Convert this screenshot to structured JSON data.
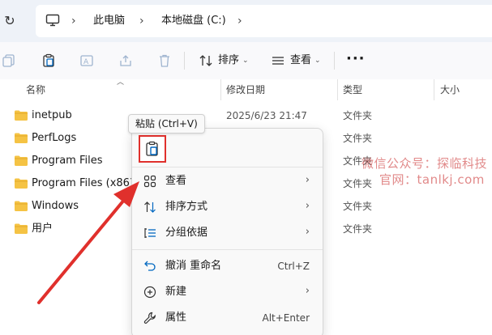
{
  "address_bar": {
    "crumbs": [
      "此电脑",
      "本地磁盘 (C:)"
    ]
  },
  "toolbar": {
    "sort_label": "排序",
    "view_label": "查看",
    "more_label": "···"
  },
  "columns": {
    "name": "名称",
    "date": "修改日期",
    "type": "类型",
    "size": "大小"
  },
  "files": [
    {
      "name": "inetpub",
      "date": "2025/6/23 21:47",
      "type": "文件夹"
    },
    {
      "name": "PerfLogs",
      "date": "",
      "type": "文件夹"
    },
    {
      "name": "Program Files",
      "date": "",
      "type": "文件夹"
    },
    {
      "name": "Program Files (x86)",
      "date": "",
      "type": "文件夹"
    },
    {
      "name": "Windows",
      "date": "",
      "type": "文件夹"
    },
    {
      "name": "用户",
      "date": "",
      "type": "文件夹"
    }
  ],
  "tooltip": "粘贴 (Ctrl+V)",
  "context_menu": {
    "view": "查看",
    "sort_by": "排序方式",
    "group_by": "分组依据",
    "undo": "撤消 重命名",
    "undo_shortcut": "Ctrl+Z",
    "new": "新建",
    "properties": "属性",
    "properties_shortcut": "Alt+Enter"
  },
  "watermark": {
    "line1": "微信公众号：探临科技",
    "line2": "官网：tanlkj.com"
  },
  "colors": {
    "accent": "#0067c0",
    "folder": "#f5c344",
    "highlight_red": "#e0302c"
  }
}
